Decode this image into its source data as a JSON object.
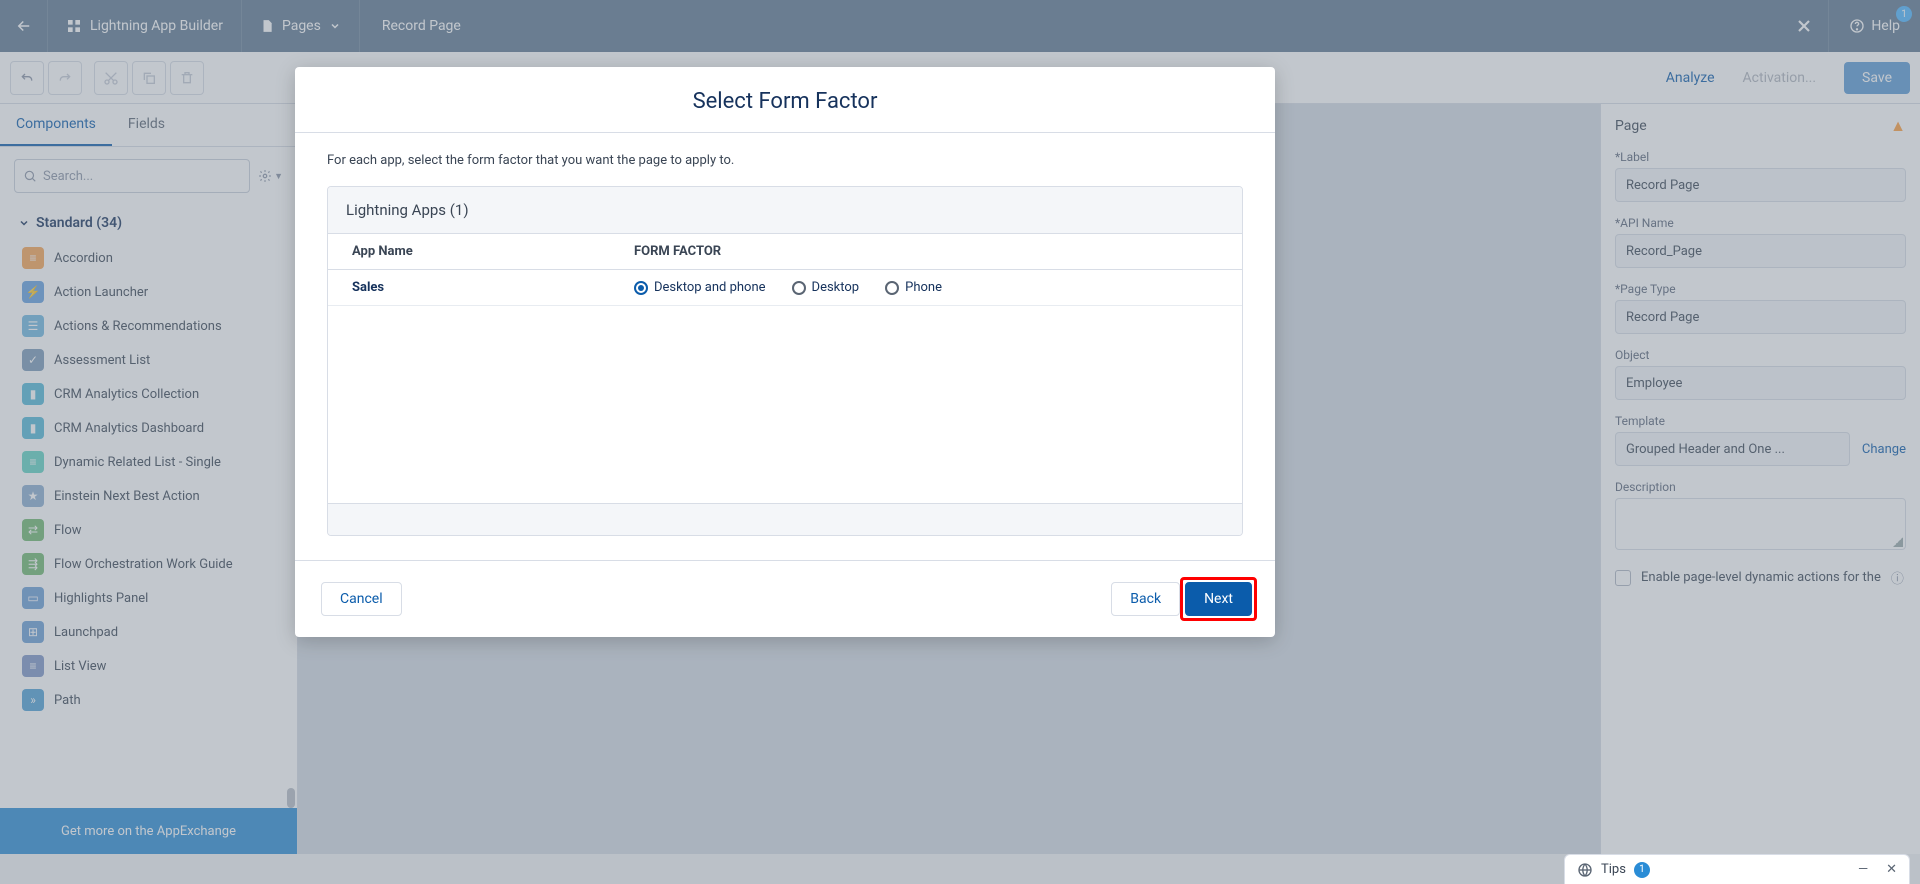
{
  "topbar": {
    "app_builder": "Lightning App Builder",
    "pages_label": "Pages",
    "record_page": "Record Page",
    "help": "Help",
    "help_badge": "1"
  },
  "toolbar": {
    "analyze": "Analyze",
    "activation": "Activation...",
    "save": "Save"
  },
  "sidebar": {
    "tab_components": "Components",
    "tab_fields": "Fields",
    "search_placeholder": "Search...",
    "section_standard": "Standard (34)",
    "components": [
      {
        "label": "Accordion",
        "color": "#f7a452"
      },
      {
        "label": "Action Launcher",
        "color": "#65a0e0"
      },
      {
        "label": "Actions & Recommendations",
        "color": "#6fb8e0"
      },
      {
        "label": "Assessment List",
        "color": "#7a99b8"
      },
      {
        "label": "CRM Analytics Collection",
        "color": "#52b8d8"
      },
      {
        "label": "CRM Analytics Dashboard",
        "color": "#52b8d8"
      },
      {
        "label": "Dynamic Related List - Single",
        "color": "#62d4c3"
      },
      {
        "label": "Einstein Next Best Action",
        "color": "#8badd0"
      },
      {
        "label": "Flow",
        "color": "#6fb86f"
      },
      {
        "label": "Flow Orchestration Work Guide",
        "color": "#6fb86f"
      },
      {
        "label": "Highlights Panel",
        "color": "#6b9ed6"
      },
      {
        "label": "Launchpad",
        "color": "#6b9ed6"
      },
      {
        "label": "List View",
        "color": "#7e95c7"
      },
      {
        "label": "Path",
        "color": "#4fa0d6"
      }
    ],
    "appexchange": "Get more on the AppExchange"
  },
  "rightpanel": {
    "header": "Page",
    "label_lbl": "*Label",
    "label_val": "Record Page",
    "api_lbl": "*API Name",
    "api_val": "Record_Page",
    "pagetype_lbl": "*Page Type",
    "pagetype_val": "Record Page",
    "object_lbl": "Object",
    "object_val": "Employee",
    "template_lbl": "Template",
    "template_val": "Grouped Header and One ...",
    "change": "Change",
    "desc_lbl": "Description",
    "dynactions": "Enable page-level dynamic actions for the"
  },
  "modal": {
    "title": "Select Form Factor",
    "desc": "For each app, select the form factor that you want the page to apply to.",
    "group_header": "Lightning Apps (1)",
    "col_app": "App Name",
    "col_ff": "FORM FACTOR",
    "row_app": "Sales",
    "opt_both": "Desktop and phone",
    "opt_desktop": "Desktop",
    "opt_phone": "Phone",
    "cancel": "Cancel",
    "back": "Back",
    "next": "Next"
  },
  "tips": {
    "label": "Tips",
    "count": "1"
  }
}
